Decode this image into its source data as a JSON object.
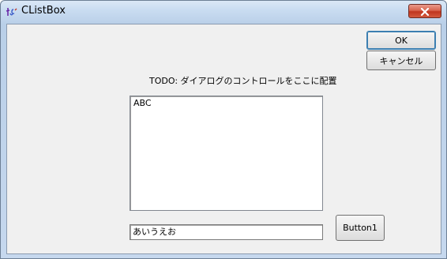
{
  "window": {
    "title": "CListBox"
  },
  "buttons": {
    "ok": "OK",
    "cancel": "キャンセル",
    "button1": "Button1"
  },
  "static_text": "TODO: ダイアログのコントロールをここに配置",
  "listbox": {
    "items": [
      "ABC"
    ]
  },
  "edit": {
    "value": "あいうえお"
  },
  "colors": {
    "title_gradient_top": "#dbe8f6",
    "close_button": "#c7402a",
    "client_bg": "#f0f0f0"
  },
  "icons": {
    "app": "mfc-app-icon",
    "close": "close-icon"
  }
}
